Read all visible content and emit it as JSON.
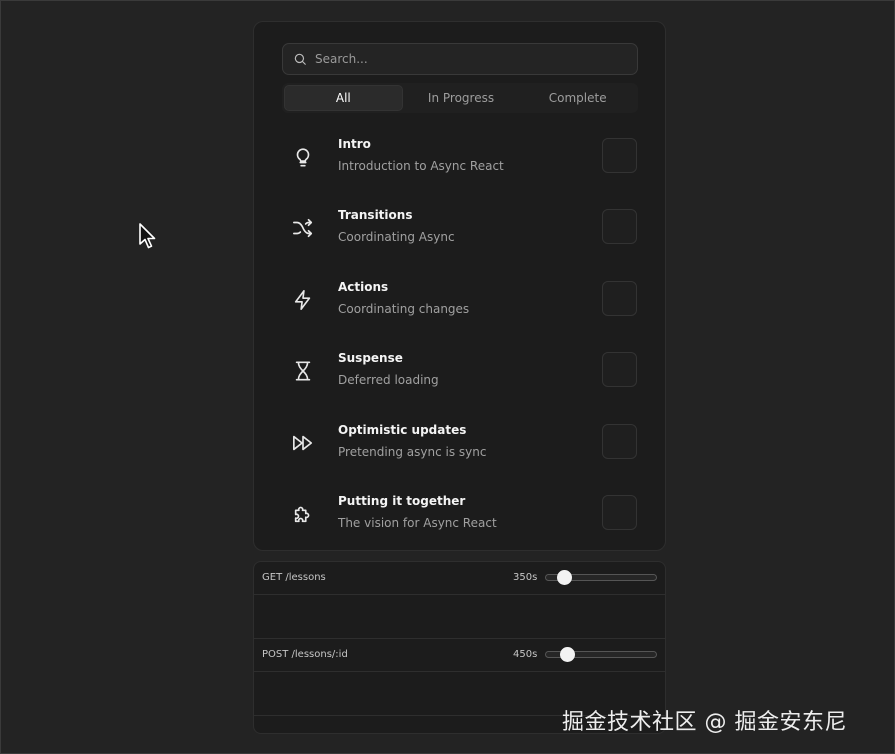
{
  "search": {
    "placeholder": "Search..."
  },
  "tabs": [
    {
      "label": "All",
      "active": true
    },
    {
      "label": "In Progress",
      "active": false
    },
    {
      "label": "Complete",
      "active": false
    }
  ],
  "lessons": [
    {
      "title": "Intro",
      "subtitle": "Introduction to Async React",
      "icon": "lightbulb-icon",
      "complete": false
    },
    {
      "title": "Transitions",
      "subtitle": "Coordinating Async",
      "icon": "shuffle-icon",
      "complete": false
    },
    {
      "title": "Actions",
      "subtitle": "Coordinating changes",
      "icon": "lightning-icon",
      "complete": false
    },
    {
      "title": "Suspense",
      "subtitle": "Deferred loading",
      "icon": "hourglass-icon",
      "complete": false
    },
    {
      "title": "Optimistic updates",
      "subtitle": "Pretending async is sync",
      "icon": "fast-forward-icon",
      "complete": false
    },
    {
      "title": "Putting it together",
      "subtitle": "The vision for Async React",
      "icon": "puzzle-icon",
      "complete": false
    }
  ],
  "requests": [
    {
      "label": "GET /lessons",
      "delay": "350s",
      "slider_fraction": 0.16
    },
    {
      "label": "POST /lessons/:id",
      "delay": "450s",
      "slider_fraction": 0.19
    }
  ],
  "watermark": "掘金技术社区 @ 掘金安东尼",
  "colors": {
    "background": "#232323",
    "card": "#1c1c1c",
    "text": "#f4f4f4",
    "muted": "#a0a0a0"
  }
}
